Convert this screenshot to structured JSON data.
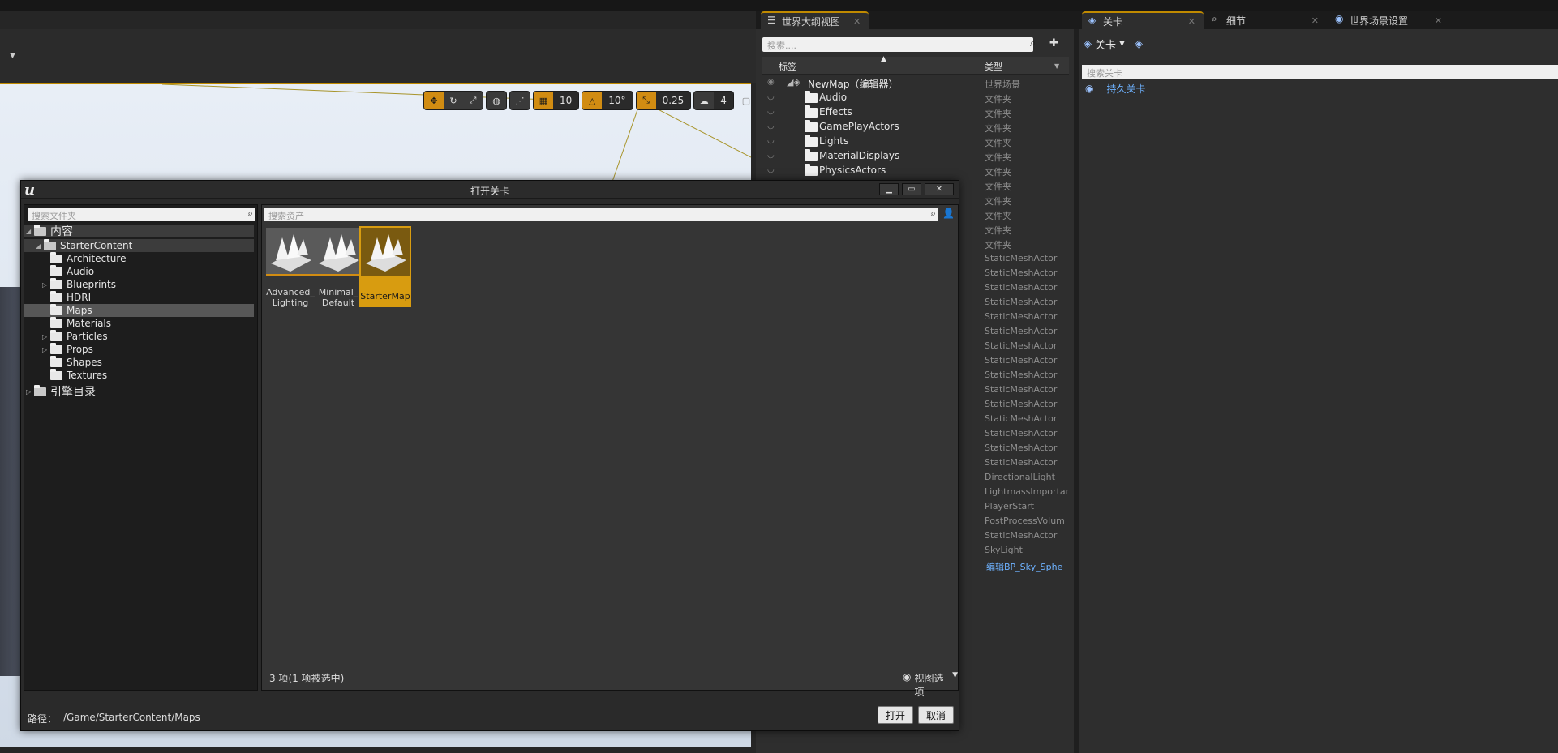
{
  "viewport": {
    "grid_value": "10",
    "rotation_value": "10°",
    "scale_value": "0.25",
    "camera_speed": "4"
  },
  "outliner": {
    "tab_label": "世界大纲视图",
    "search_placeholder": "搜索....",
    "col_label": "标签",
    "col_type": "类型",
    "rows": [
      {
        "name": "NewMap（编辑器）",
        "type": "世界场景"
      },
      {
        "name": "Audio",
        "type": "文件夹"
      },
      {
        "name": "Effects",
        "type": "文件夹"
      },
      {
        "name": "GamePlayActors",
        "type": "文件夹"
      },
      {
        "name": "Lights",
        "type": "文件夹"
      },
      {
        "name": "MaterialDisplays",
        "type": "文件夹"
      },
      {
        "name": "PhysicsActors",
        "type": "文件夹"
      }
    ],
    "extra_types": [
      "文件夹",
      "文件夹",
      "文件夹",
      "文件夹",
      "文件夹",
      "StaticMeshActor",
      "StaticMeshActor",
      "StaticMeshActor",
      "StaticMeshActor",
      "StaticMeshActor",
      "StaticMeshActor",
      "StaticMeshActor",
      "StaticMeshActor",
      "StaticMeshActor",
      "StaticMeshActor",
      "StaticMeshActor",
      "StaticMeshActor",
      "StaticMeshActor",
      "StaticMeshActor",
      "StaticMeshActor",
      "DirectionalLight",
      "LightmassImportar",
      "PlayerStart",
      "PostProcessVolum",
      "StaticMeshActor",
      "SkyLight"
    ],
    "link_type": "编辑BP_Sky_Sphe"
  },
  "right_tabs": {
    "levels": "关卡",
    "details": "细节",
    "world_settings": "世界场景设置"
  },
  "levels": {
    "title": "关卡",
    "search_placeholder": "搜索关卡",
    "persistent": "持久关卡"
  },
  "dialog": {
    "title": "打开关卡",
    "folder_search_placeholder": "搜索文件夹",
    "asset_search_placeholder": "搜索资产",
    "folders": [
      {
        "label": "内容",
        "level": 0
      },
      {
        "label": "StarterContent",
        "level": 1
      },
      {
        "label": "Architecture",
        "level": 2
      },
      {
        "label": "Audio",
        "level": 2
      },
      {
        "label": "Blueprints",
        "level": 2
      },
      {
        "label": "HDRI",
        "level": 2
      },
      {
        "label": "Maps",
        "level": 2
      },
      {
        "label": "Materials",
        "level": 2
      },
      {
        "label": "Particles",
        "level": 2
      },
      {
        "label": "Props",
        "level": 2
      },
      {
        "label": "Shapes",
        "level": 2
      },
      {
        "label": "Textures",
        "level": 2
      },
      {
        "label": "引擎目录",
        "level": 0
      }
    ],
    "assets": [
      {
        "label": "Advanced_ Lighting"
      },
      {
        "label": "Minimal_ Default"
      },
      {
        "label": "StarterMap"
      }
    ],
    "count_text": "3 项(1 项被选中)",
    "view_options": "视图选项",
    "path_label": "路径：",
    "path_value": "/Game/StarterContent/Maps",
    "open_button": "打开",
    "cancel_button": "取消"
  }
}
